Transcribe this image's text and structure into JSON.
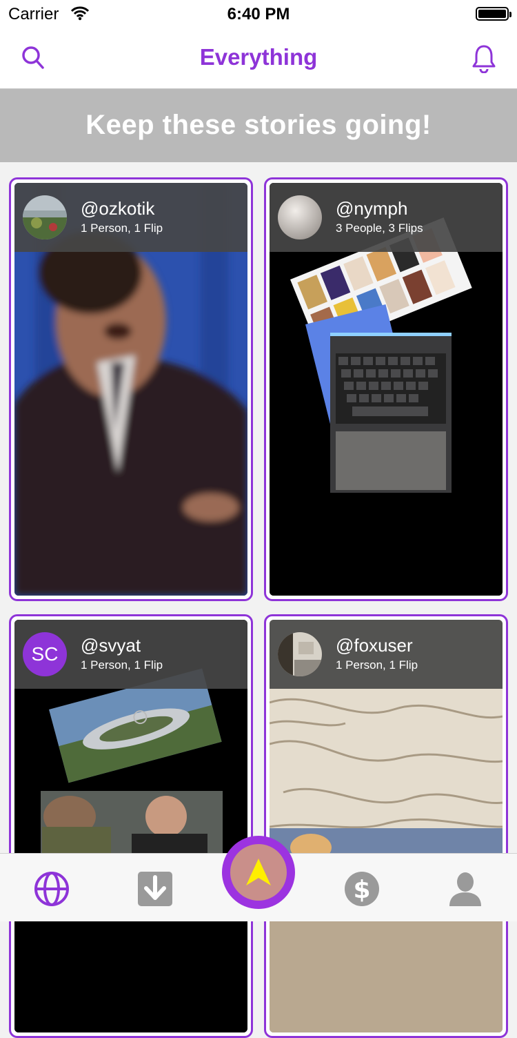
{
  "status_bar": {
    "carrier": "Carrier",
    "time": "6:40 PM"
  },
  "nav": {
    "title": "Everything",
    "left_icon": "search-icon",
    "right_icon": "bell-icon"
  },
  "banner": {
    "text": "Keep these stories going!"
  },
  "colors": {
    "accent": "#8e34d8",
    "banner_bg": "#b9b9b9",
    "header_overlay": "#464646"
  },
  "cards": [
    {
      "username": "@ozkotik",
      "meta": "1 Person, 1 Flip",
      "avatar": "photo"
    },
    {
      "username": "@nymph",
      "meta": "3 People, 3 Flips",
      "avatar": "photo"
    },
    {
      "username": "@svyat",
      "meta": "1 Person, 1 Flip",
      "avatar": "initials",
      "initials": "SC"
    },
    {
      "username": "@foxuser",
      "meta": "1 Person, 1 Flip",
      "avatar": "photo"
    }
  ],
  "tabs": [
    {
      "icon": "globe-icon",
      "active": true
    },
    {
      "icon": "download-icon",
      "active": false
    },
    {
      "icon": "create-arrow-icon",
      "active": false
    },
    {
      "icon": "dollar-icon",
      "active": false
    },
    {
      "icon": "profile-icon",
      "active": false
    }
  ]
}
